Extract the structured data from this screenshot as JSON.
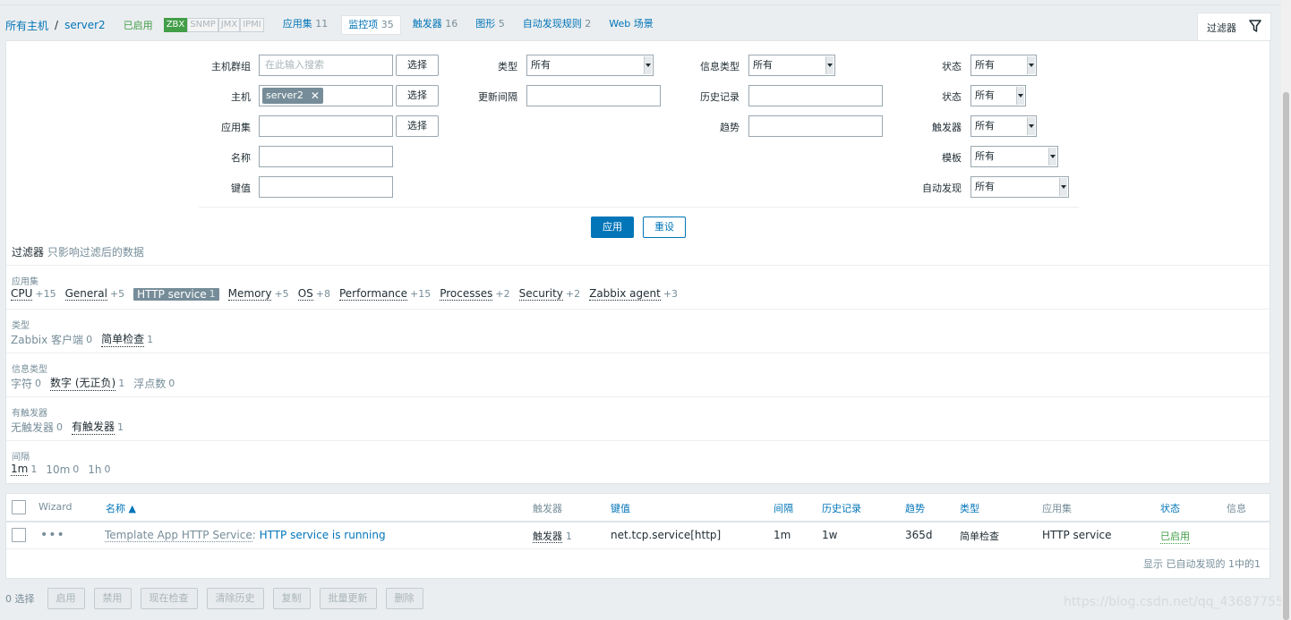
{
  "nav": {
    "all_hosts": "所有主机",
    "separator": "/",
    "host": "server2",
    "status": "已启用",
    "availability": [
      "ZBX",
      "SNMP",
      "JMX",
      "IPMI"
    ],
    "tabs": [
      {
        "label": "应用集",
        "count": "11"
      },
      {
        "label": "监控项",
        "count": "35"
      },
      {
        "label": "触发器",
        "count": "16"
      },
      {
        "label": "图形",
        "count": "5"
      },
      {
        "label": "自动发现规则",
        "count": "2"
      },
      {
        "label": "Web 场景",
        "count": ""
      }
    ],
    "filter_tab": "过滤器"
  },
  "filter": {
    "host_group_label": "主机群组",
    "host_group_placeholder": "在此输入搜索",
    "host_label": "主机",
    "host_chip": "server2",
    "app_label": "应用集",
    "name_label": "名称",
    "key_label": "键值",
    "select_btn": "选择",
    "type_label": "类型",
    "type_value": "所有",
    "interval_label": "更新间隔",
    "info_type_label": "信息类型",
    "info_type_value": "所有",
    "history_label": "历史记录",
    "trend_label": "趋势",
    "state_label": "状态",
    "state_value": "所有",
    "status_label": "状态",
    "status_value": "所有",
    "triggers_label": "触发器",
    "triggers_value": "所有",
    "template_label": "模板",
    "template_value": "所有",
    "discovery_label": "自动发现",
    "discovery_value": "所有",
    "apply": "应用",
    "reset": "重设"
  },
  "subfilter": {
    "title": "过滤器",
    "hint": "只影响过滤后的数据",
    "groups": [
      {
        "label": "应用集",
        "items": [
          {
            "name": "CPU",
            "count": "+15"
          },
          {
            "name": "General",
            "count": "+5"
          },
          {
            "name": "HTTP service",
            "count": "1",
            "selected": true
          },
          {
            "name": "Memory",
            "count": "+5"
          },
          {
            "name": "OS",
            "count": "+8"
          },
          {
            "name": "Performance",
            "count": "+15"
          },
          {
            "name": "Processes",
            "count": "+2"
          },
          {
            "name": "Security",
            "count": "+2"
          },
          {
            "name": "Zabbix agent",
            "count": "+3"
          }
        ]
      },
      {
        "label": "类型",
        "items": [
          {
            "name": "Zabbix 客户端",
            "count": "0",
            "grey": true
          },
          {
            "name": "简单检查",
            "count": "1"
          }
        ]
      },
      {
        "label": "信息类型",
        "items": [
          {
            "name": "字符",
            "count": "0",
            "grey": true
          },
          {
            "name": "数字 (无正负)",
            "count": "1"
          },
          {
            "name": "浮点数",
            "count": "0",
            "grey": true
          }
        ]
      },
      {
        "label": "有触发器",
        "items": [
          {
            "name": "无触发器",
            "count": "0",
            "grey": true
          },
          {
            "name": "有触发器",
            "count": "1"
          }
        ]
      },
      {
        "label": "间隔",
        "items": [
          {
            "name": "1m",
            "count": "1"
          },
          {
            "name": "10m",
            "count": "0",
            "grey": true
          },
          {
            "name": "1h",
            "count": "0",
            "grey": true
          }
        ]
      }
    ]
  },
  "table": {
    "headers": {
      "wizard": "Wizard",
      "name": "名称 ▲",
      "triggers": "触发器",
      "key": "键值",
      "interval": "间隔",
      "history": "历史记录",
      "trends": "趋势",
      "type": "类型",
      "applications": "应用集",
      "status": "状态",
      "info": "信息"
    },
    "row": {
      "template": "Template App HTTP Service",
      "name": "HTTP service is running",
      "triggers": "触发器",
      "triggers_count": "1",
      "key": "net.tcp.service[http]",
      "interval": "1m",
      "history": "1w",
      "trends": "365d",
      "type": "简单检查",
      "applications": "HTTP service",
      "status": "已启用"
    },
    "footer": "显示 已自动发现的 1中的1"
  },
  "bottom": {
    "selected": "0 选择",
    "buttons": [
      "启用",
      "禁用",
      "现在检查",
      "清除历史",
      "复制",
      "批量更新",
      "删除"
    ]
  },
  "watermark": "https://blog.csdn.net/qq_43687755",
  "colors": {
    "accent": "#0275b8",
    "enabled": "#429e47",
    "muted": "#768d99"
  }
}
